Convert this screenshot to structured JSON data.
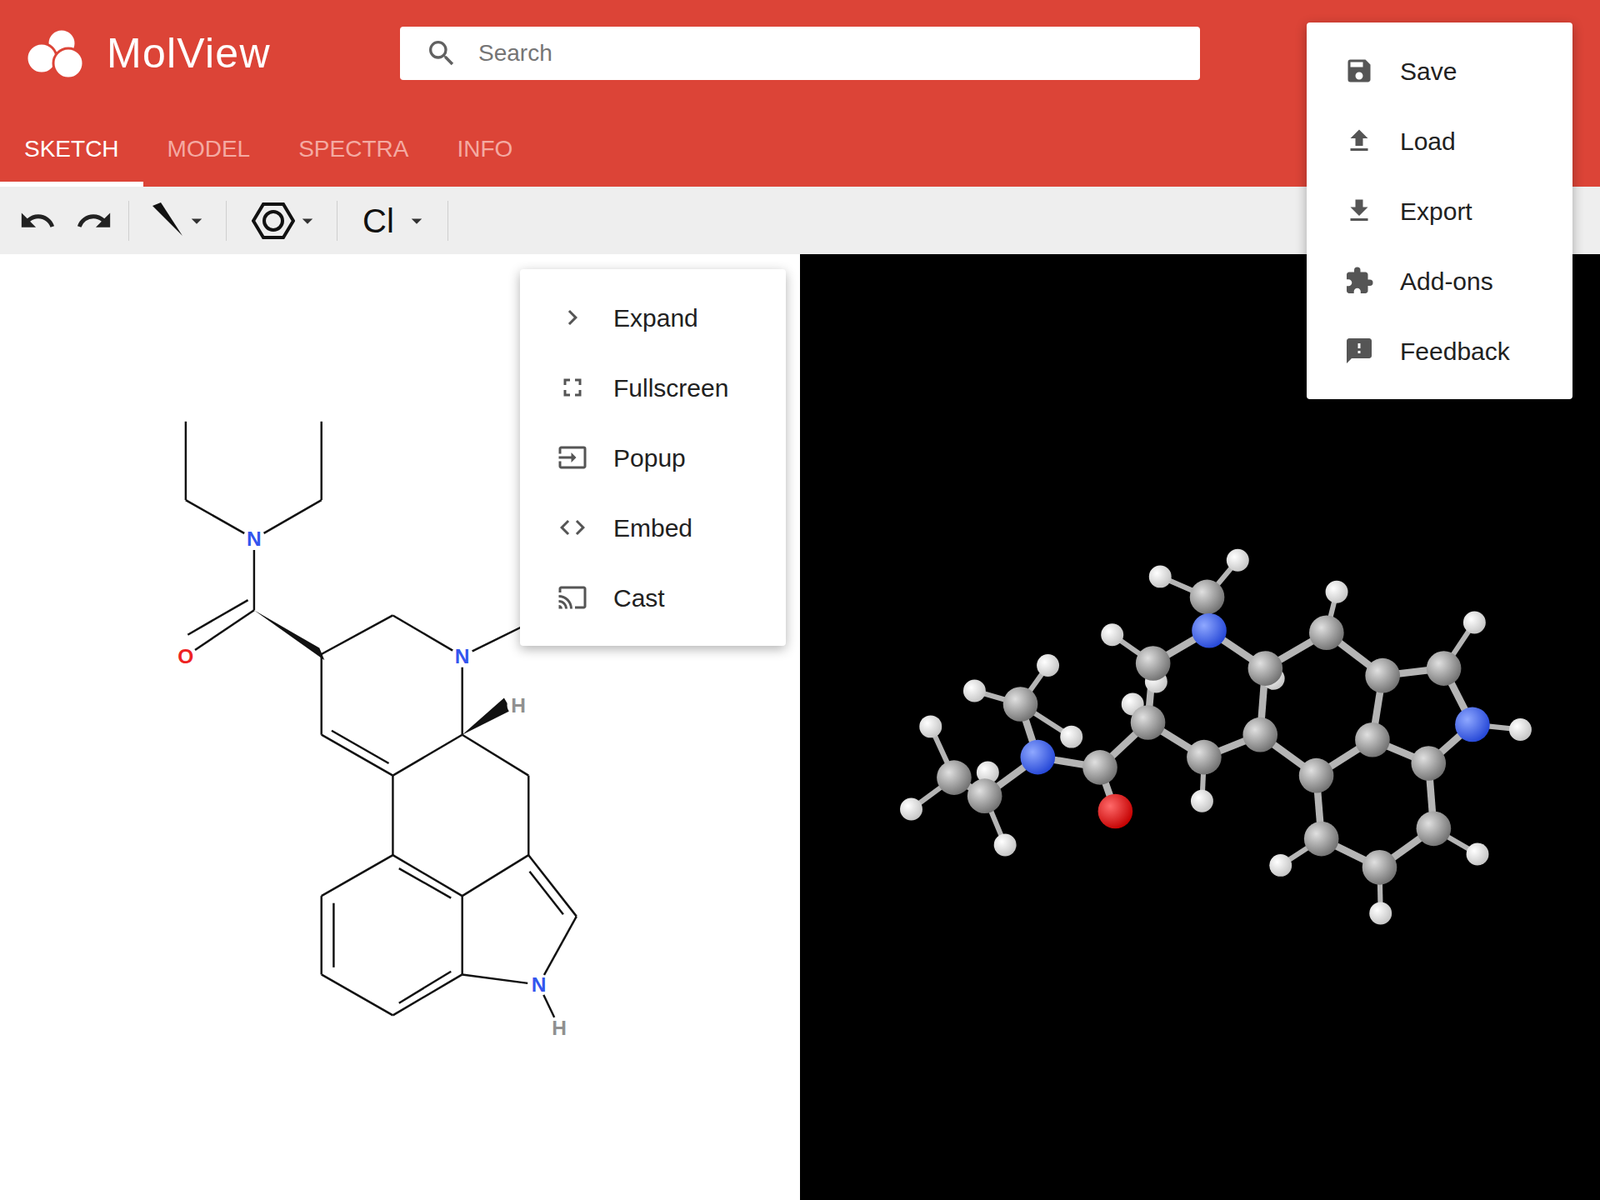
{
  "app": {
    "logo": "MolView"
  },
  "search": {
    "placeholder": "Search"
  },
  "tabs": [
    {
      "label": "SKETCH",
      "selected": true
    },
    {
      "label": "MODEL",
      "selected": false
    },
    {
      "label": "SPECTRA",
      "selected": false
    },
    {
      "label": "INFO",
      "selected": false
    }
  ],
  "toolbar": {
    "element": "Cl"
  },
  "view_menu": {
    "items": [
      {
        "label": "Expand"
      },
      {
        "label": "Fullscreen"
      },
      {
        "label": "Popup"
      },
      {
        "label": "Embed"
      },
      {
        "label": "Cast"
      }
    ]
  },
  "main_menu": {
    "items": [
      {
        "label": "Save"
      },
      {
        "label": "Load"
      },
      {
        "label": "Export"
      },
      {
        "label": "Add-ons"
      },
      {
        "label": "Feedback"
      }
    ]
  },
  "sketch": {
    "atoms": [
      {
        "label": "N",
        "color": "#3355ee"
      },
      {
        "label": "O",
        "color": "#ee2222"
      },
      {
        "label": "N",
        "color": "#3355ee"
      },
      {
        "label": "H",
        "color": "#909090"
      },
      {
        "label": "N",
        "color": "#3355ee"
      },
      {
        "label": "H",
        "color": "#909090"
      }
    ]
  }
}
